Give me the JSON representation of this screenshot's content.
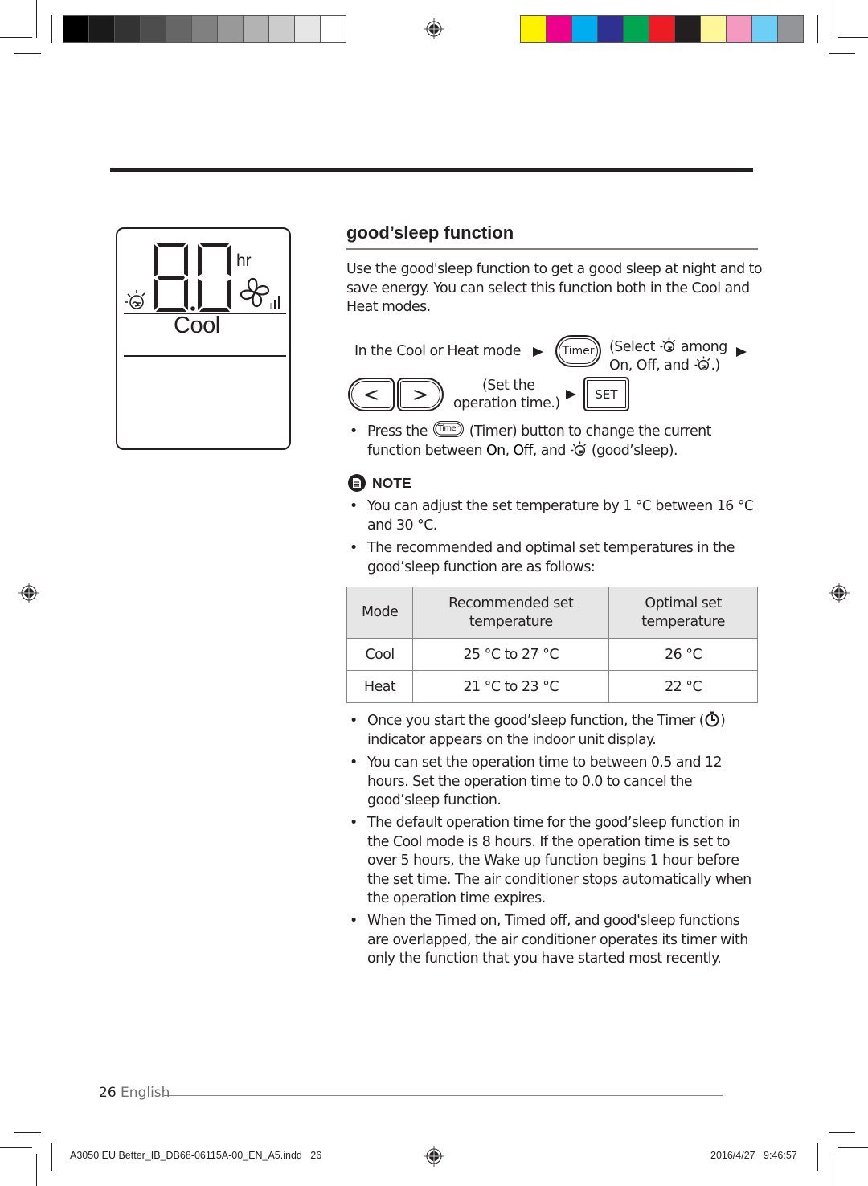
{
  "print_marks": {
    "gray_swatches": [
      "#000000",
      "#1a1a1a",
      "#333333",
      "#4d4d4d",
      "#666666",
      "#808080",
      "#999999",
      "#b3b3b3",
      "#cccccc",
      "#e6e6e6",
      "#ffffff"
    ],
    "color_swatches": [
      "#fff200",
      "#ec008c",
      "#00aeef",
      "#2e3192",
      "#00a651",
      "#ed1c24",
      "#231f20",
      "#fff799",
      "#f49ac1",
      "#6dcff6",
      "#939598"
    ]
  },
  "lcd_display": {
    "time_value": "8.0",
    "time_unit": "hr",
    "mode": "Cool",
    "icons": [
      "goodsleep-icon",
      "fan-icon",
      "fan-speed-icon"
    ]
  },
  "section": {
    "title": "good’sleep function",
    "intro": "Use the good'sleep function to get a good sleep at night and to save energy. You can select this function both in the Cool and Heat modes."
  },
  "flow": {
    "step1_text": "In the Cool or Heat mode",
    "timer_button": "Timer",
    "step2_line1_a": "(Select",
    "step2_line1_b": "among",
    "step2_line2_a": "On, Off, and",
    "step2_line2_b": ".)",
    "left_button": "<",
    "right_button": ">",
    "step3_line1": "(Set the",
    "step3_line2": "operation time.)",
    "set_button": "SET"
  },
  "press_bullet": {
    "part1": "Press the",
    "timer_label": "Timer",
    "part2": "(Timer) button to change the current",
    "part3": "function between ",
    "on": "On",
    "comma": ", ",
    "off": "Off",
    "part4": ", and",
    "part5": "(good’sleep)."
  },
  "note": {
    "title": "NOTE",
    "bullets": [
      "You can adjust the set temperature by 1 °C between 16 °C and 30 °C.",
      "The recommended and optimal set temperatures in the good’sleep function are as follows:"
    ]
  },
  "temp_table": {
    "headers": [
      "Mode",
      "Recommended set temperature",
      "Optimal set temperature"
    ],
    "rows": [
      [
        "Cool",
        "25 °C to 27 °C",
        "26 °C"
      ],
      [
        "Heat",
        "21 °C to 23 °C",
        "22 °C"
      ]
    ]
  },
  "after_bullets": {
    "timer_indicator_part1": "Once you start the good’sleep function, the Timer (",
    "timer_indicator_part2": ") indicator appears on the indoor unit display.",
    "items": [
      "You can set the operation time to between 0.5 and 12 hours. Set the operation time to 0.0 to cancel the good’sleep function.",
      "The default operation time for the good’sleep function in the Cool mode is 8 hours. If the operation time is set to over 5 hours, the Wake up function begins 1 hour before the set time. The air conditioner stops automatically when the operation time expires.",
      "When the Timed on, Timed off, and good'sleep functions are overlapped, the air conditioner operates its timer with only the function that you have started most recently."
    ]
  },
  "footer": {
    "page_number": "26",
    "language": "English",
    "slug_file": "A3050 EU Better_IB_DB68-06115A-00_EN_A5.indd   26",
    "slug_date": "2016/4/27   9:46:57"
  }
}
